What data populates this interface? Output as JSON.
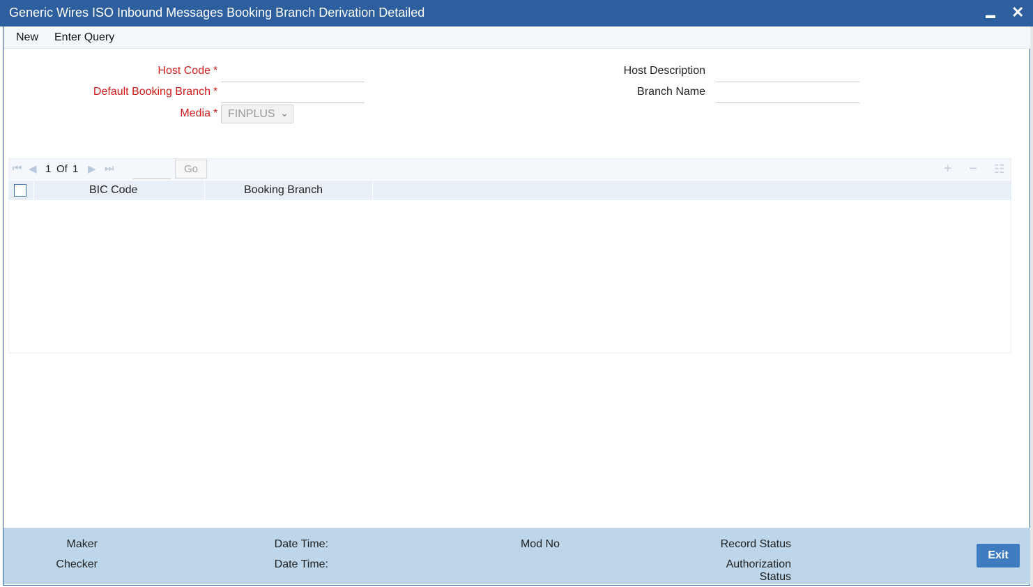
{
  "window": {
    "title": "Generic Wires ISO Inbound Messages Booking Branch Derivation Detailed",
    "minimize_glyph": "▬",
    "close_glyph": "✕"
  },
  "menu": {
    "new": "New",
    "enter_query": "Enter Query"
  },
  "form": {
    "host_code_label": "Host Code",
    "default_booking_branch_label": "Default Booking Branch",
    "media_label": "Media",
    "media_value": "FINPLUS",
    "host_description_label": "Host Description",
    "branch_name_label": "Branch Name",
    "required_mark": "*"
  },
  "grid": {
    "pager": {
      "current": "1",
      "of_label": "Of",
      "total": "1",
      "go_label": "Go"
    },
    "columns": [
      "BIC Code",
      "Booking Branch"
    ],
    "rows": []
  },
  "footer": {
    "maker": "Maker",
    "checker": "Checker",
    "date_time_1": "Date Time:",
    "date_time_2": "Date Time:",
    "mod_no": "Mod No",
    "record_status": "Record Status",
    "authorization_status_line1": "Authorization",
    "authorization_status_line2": "Status",
    "exit": "Exit"
  },
  "colors": {
    "title_bar": "#2d5f9e",
    "required_label": "#d11a1a",
    "footer_bg": "#bdd6ea",
    "exit_button": "#3e7cbf"
  }
}
